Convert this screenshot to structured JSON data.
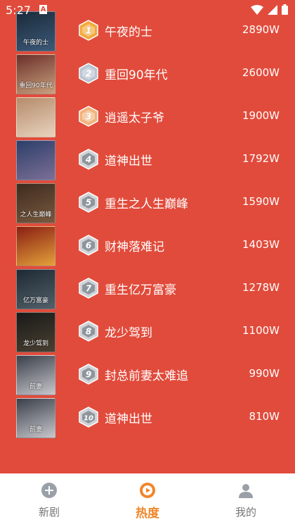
{
  "status": {
    "time": "5:27",
    "a_badge": "A"
  },
  "ranking": [
    {
      "rank": "1",
      "title": "午夜的士",
      "views": "2890W",
      "badge": "gold",
      "poster_colors": [
        "#1b2a3a",
        "#3c5a78"
      ],
      "poster_text": "午夜的士"
    },
    {
      "rank": "2",
      "title": "重回90年代",
      "views": "2600W",
      "badge": "silver",
      "poster_colors": [
        "#6b2f2a",
        "#c9a27e"
      ],
      "poster_text": "重回90年代"
    },
    {
      "rank": "3",
      "title": "逍遥太子爷",
      "views": "1900W",
      "badge": "bronze",
      "poster_colors": [
        "#b58b6a",
        "#e8d3bf"
      ],
      "poster_text": ""
    },
    {
      "rank": "4",
      "title": "道神出世",
      "views": "1792W",
      "badge": "plain",
      "poster_colors": [
        "#2c3f6a",
        "#7c6f96"
      ],
      "poster_text": ""
    },
    {
      "rank": "5",
      "title": "重生之人生巅峰",
      "views": "1590W",
      "badge": "plain",
      "poster_colors": [
        "#3d2b1f",
        "#7a5a3f"
      ],
      "poster_text": "之人生巅峰"
    },
    {
      "rank": "6",
      "title": "财神落难记",
      "views": "1403W",
      "badge": "plain",
      "poster_colors": [
        "#8a1e14",
        "#e3a23a"
      ],
      "poster_text": ""
    },
    {
      "rank": "7",
      "title": "重生亿万富豪",
      "views": "1278W",
      "badge": "plain",
      "poster_colors": [
        "#1e2a33",
        "#51606a"
      ],
      "poster_text": "亿万富豪"
    },
    {
      "rank": "8",
      "title": "龙少驾到",
      "views": "1100W",
      "badge": "plain",
      "poster_colors": [
        "#1a1a1a",
        "#4a4030"
      ],
      "poster_text": "龙少驾到"
    },
    {
      "rank": "9",
      "title": "封总前妻太难追",
      "views": "990W",
      "badge": "plain",
      "poster_colors": [
        "#3a3f4a",
        "#c7c7cc"
      ],
      "poster_text": "前妻"
    },
    {
      "rank": "10",
      "title": "道神出世",
      "views": "810W",
      "badge": "plain",
      "poster_colors": [
        "#3a3f4a",
        "#c7c7cc"
      ],
      "poster_text": "前妻"
    }
  ],
  "tabs": [
    {
      "label": "新剧",
      "icon": "plus-circle-icon",
      "active": false
    },
    {
      "label": "热度",
      "icon": "play-circle-icon",
      "active": true
    },
    {
      "label": "我的",
      "icon": "person-icon",
      "active": false
    }
  ],
  "colors": {
    "background": "#e14b3b",
    "accent": "#f0862a",
    "gold": "#f2a93b",
    "silver": "#b9c3d1",
    "bronze": "#f0b27a",
    "plain": "#cfd3d8"
  }
}
